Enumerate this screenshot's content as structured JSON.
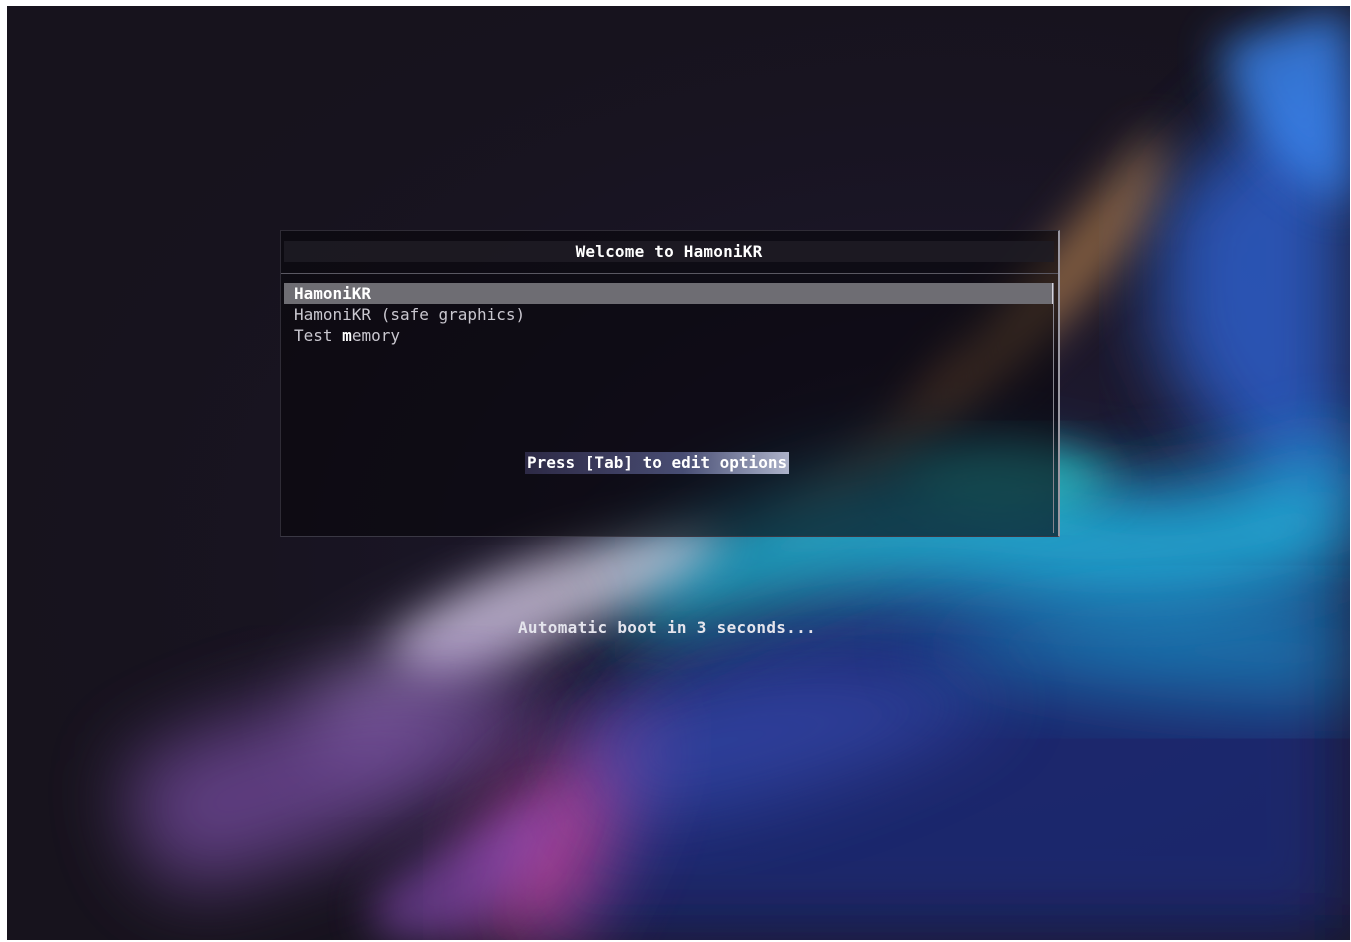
{
  "boot_menu": {
    "title": "Welcome to HamoniKR",
    "items": [
      {
        "label": "HamoniKR",
        "selected": true
      },
      {
        "label": "HamoniKR (safe graphics)",
        "selected": false
      },
      {
        "prefix": "Test ",
        "hotkey": "m",
        "suffix": "emory",
        "selected": false
      }
    ],
    "help_text": "Press [Tab] to edit options"
  },
  "countdown_text": "Automatic boot in 3 seconds...",
  "colors": {
    "background": "#181420",
    "selected_item": "#6e6d73",
    "text": "#ffffff"
  }
}
